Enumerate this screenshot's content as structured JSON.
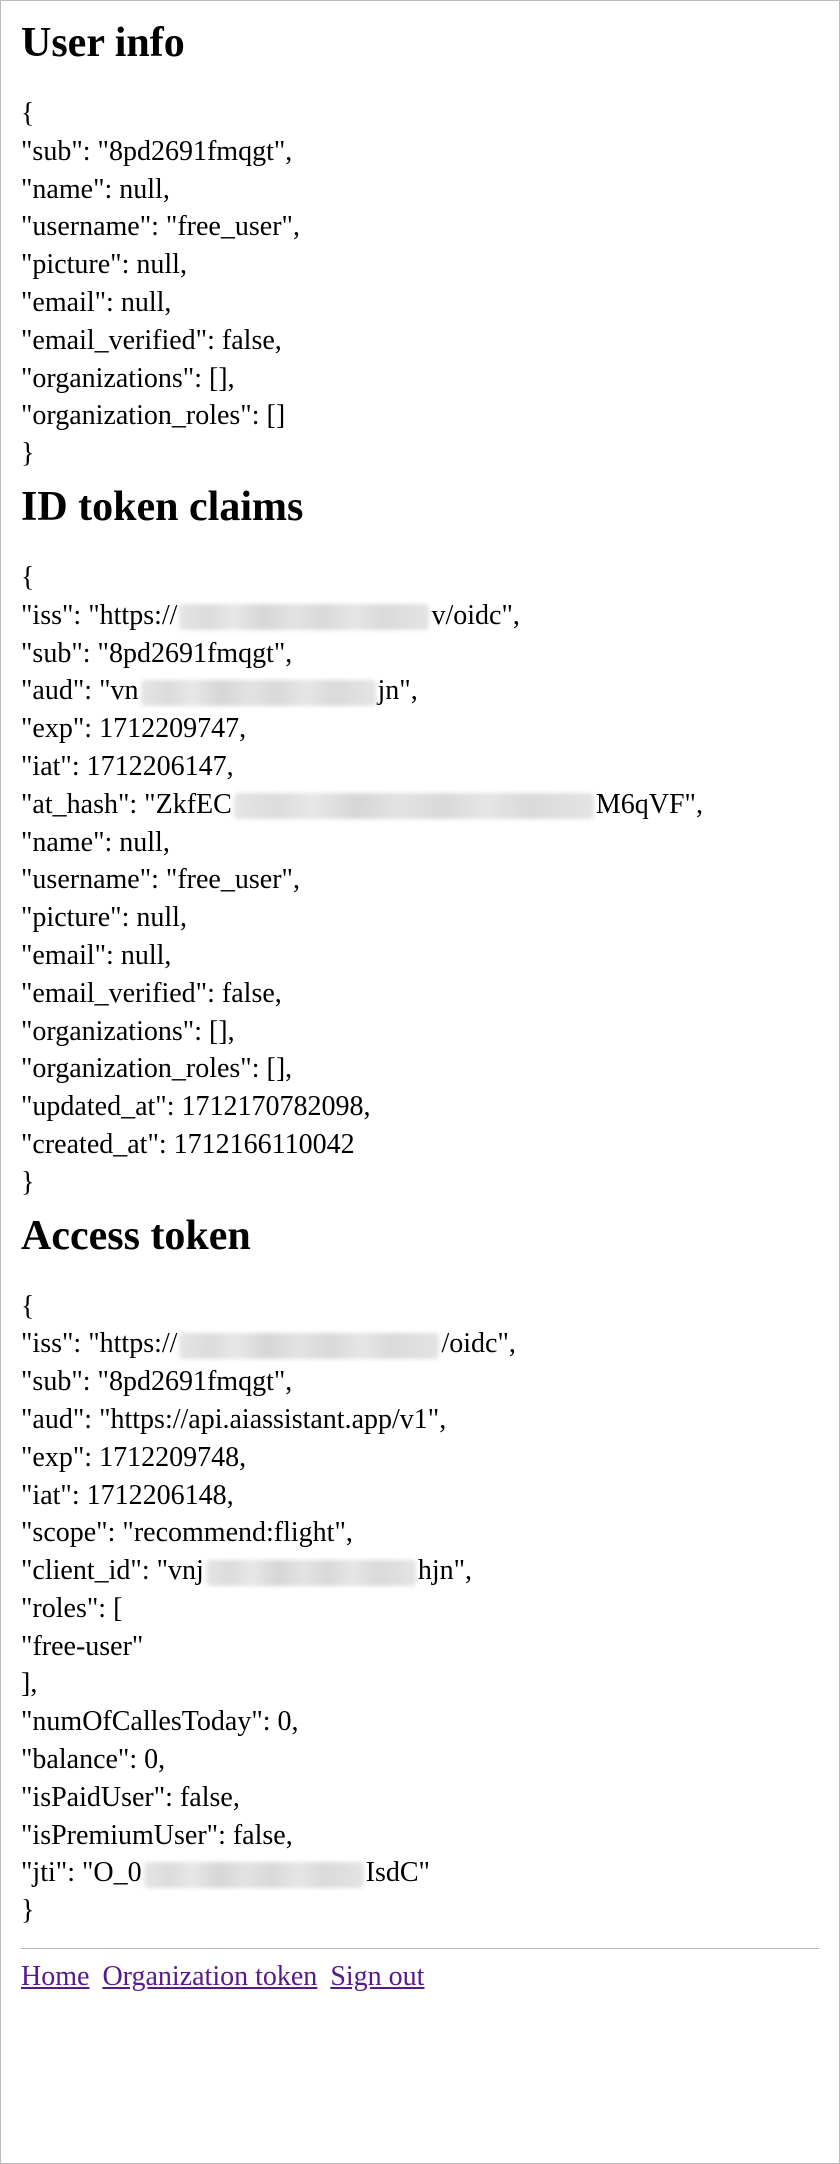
{
  "sections": {
    "user_info": {
      "title": "User info",
      "fields": {
        "sub": "8pd2691fmqgt",
        "name": "null",
        "username": "free_user",
        "picture": "null",
        "email": "null",
        "email_verified": "false",
        "organizations": "[]",
        "organization_roles": "[]"
      }
    },
    "id_token": {
      "title": "ID token claims",
      "fields": {
        "iss_prefix": "https://",
        "iss_suffix": "v/oidc",
        "sub": "8pd2691fmqgt",
        "aud_prefix": "vn",
        "aud_suffix": "jn",
        "exp": "1712209747",
        "iat": "1712206147",
        "at_hash_prefix": "ZkfEC",
        "at_hash_suffix": "M6qVF",
        "name": "null",
        "username": "free_user",
        "picture": "null",
        "email": "null",
        "email_verified": "false",
        "organizations": "[]",
        "organization_roles": "[]",
        "updated_at": "1712170782098",
        "created_at": "1712166110042"
      }
    },
    "access_token": {
      "title": "Access token",
      "fields": {
        "iss_prefix": "https://",
        "iss_suffix": "/oidc",
        "sub": "8pd2691fmqgt",
        "aud": "https://api.aiassistant.app/v1",
        "exp": "1712209748",
        "iat": "1712206148",
        "scope": "recommend:flight",
        "client_id_prefix": "vnj",
        "client_id_suffix": "hjn",
        "roles_item": "free-user",
        "numOfCallesToday": "0",
        "balance": "0",
        "isPaidUser": "false",
        "isPremiumUser": "false",
        "jti_prefix": "O_0",
        "jti_suffix": "IsdC"
      }
    }
  },
  "nav": {
    "home": "Home",
    "org_token": "Organization token",
    "sign_out": "Sign out"
  }
}
